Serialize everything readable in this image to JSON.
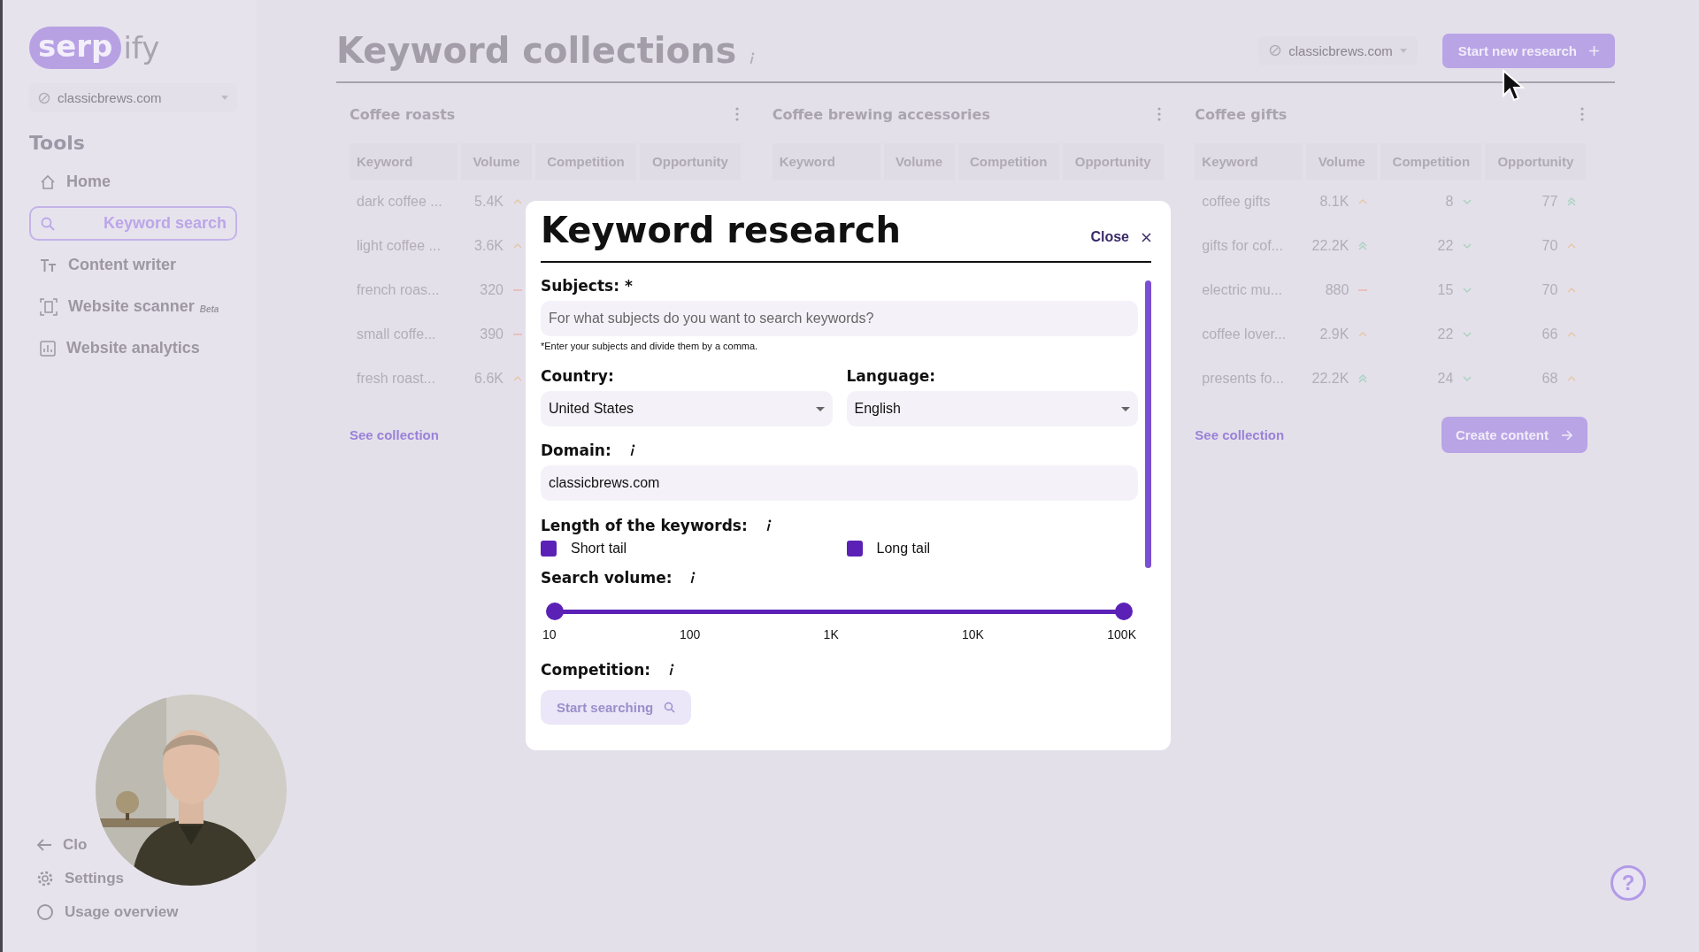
{
  "sidebar": {
    "logo": {
      "pill": "serp",
      "rest": "ify"
    },
    "domain": "classicbrews.com",
    "section_title": "Tools",
    "items": [
      {
        "label": "Home",
        "selected": false
      },
      {
        "label": "Keyword search",
        "selected": true
      },
      {
        "label": "Content writer",
        "selected": false
      },
      {
        "label": "Website scanner",
        "badge": "Beta",
        "selected": false
      },
      {
        "label": "Website analytics",
        "selected": false
      }
    ],
    "bottom_items": [
      {
        "label": "Clo"
      },
      {
        "label": "Settings"
      },
      {
        "label": "Usage overview"
      }
    ]
  },
  "header": {
    "title": "Keyword collections",
    "domain": "classicbrews.com",
    "new_button": "Start new research"
  },
  "collections": [
    {
      "title": "Coffee roasts",
      "columns": [
        "Keyword",
        "Volume",
        "Competition",
        "Opportunity"
      ],
      "rows": [
        {
          "keyword": "dark coffee ...",
          "volume": "5.4K",
          "volume_trend": {
            "kind": "up"
          }
        },
        {
          "keyword": "light coffee ...",
          "volume": "3.6K",
          "volume_trend": {
            "kind": "up"
          }
        },
        {
          "keyword": "french roas...",
          "volume": "320",
          "volume_trend": {
            "kind": "flat"
          }
        },
        {
          "keyword": "small coffe...",
          "volume": "390",
          "volume_trend": {
            "kind": "flat"
          }
        },
        {
          "keyword": "fresh roast...",
          "volume": "6.6K",
          "volume_trend": {
            "kind": "up"
          }
        }
      ],
      "link": "See collection"
    },
    {
      "title": "Coffee brewing accessories",
      "columns": [
        "Keyword",
        "Volume",
        "Competition",
        "Opportunity"
      ]
    },
    {
      "title": "Coffee gifts",
      "columns": [
        "Keyword",
        "Volume",
        "Competition",
        "Opportunity"
      ],
      "rows": [
        {
          "keyword": "coffee gifts",
          "volume": "8.1K",
          "volume_trend": {
            "kind": "up"
          },
          "competition": "8",
          "competition_trend": {
            "kind": "down"
          },
          "opportunity": "77",
          "opportunity_trend": {
            "kind": "double_up"
          }
        },
        {
          "keyword": "gifts for cof...",
          "volume": "22.2K",
          "volume_trend": {
            "kind": "double_up"
          },
          "competition": "22",
          "competition_trend": {
            "kind": "down"
          },
          "opportunity": "70",
          "opportunity_trend": {
            "kind": "up"
          }
        },
        {
          "keyword": "electric mu...",
          "volume": "880",
          "volume_trend": {
            "kind": "flat"
          },
          "competition": "15",
          "competition_trend": {
            "kind": "down"
          },
          "opportunity": "70",
          "opportunity_trend": {
            "kind": "up"
          }
        },
        {
          "keyword": "coffee lover...",
          "volume": "2.9K",
          "volume_trend": {
            "kind": "up"
          },
          "competition": "22",
          "competition_trend": {
            "kind": "down"
          },
          "opportunity": "66",
          "opportunity_trend": {
            "kind": "up"
          }
        },
        {
          "keyword": "presents fo...",
          "volume": "22.2K",
          "volume_trend": {
            "kind": "double_up"
          },
          "competition": "24",
          "competition_trend": {
            "kind": "down"
          },
          "opportunity": "68",
          "opportunity_trend": {
            "kind": "up"
          }
        }
      ],
      "link": "See collection",
      "action": "Create content"
    }
  ],
  "modal": {
    "title": "Keyword research",
    "close": "Close",
    "subjects": {
      "label": "Subjects: *",
      "placeholder": "For what subjects do you want to search keywords?",
      "hint": "*Enter your subjects and divide them by a comma."
    },
    "country": {
      "label": "Country:",
      "value": "United States"
    },
    "language": {
      "label": "Language:",
      "value": "English"
    },
    "domain": {
      "label": "Domain:",
      "value": "classicbrews.com"
    },
    "length": {
      "label": "Length of the keywords:",
      "options": [
        {
          "label": "Short tail",
          "checked": true
        },
        {
          "label": "Long tail",
          "checked": true
        }
      ]
    },
    "volume": {
      "label": "Search volume:",
      "thumbs": [
        {
          "level": 0
        },
        {
          "level": 1
        }
      ],
      "ticks": [
        "10",
        "100",
        "1K",
        "10K",
        "100K"
      ]
    },
    "competition": {
      "label": "Competition:"
    },
    "submit": {
      "label": "Start searching",
      "disabled": true
    }
  },
  "help": {
    "label": "?"
  }
}
